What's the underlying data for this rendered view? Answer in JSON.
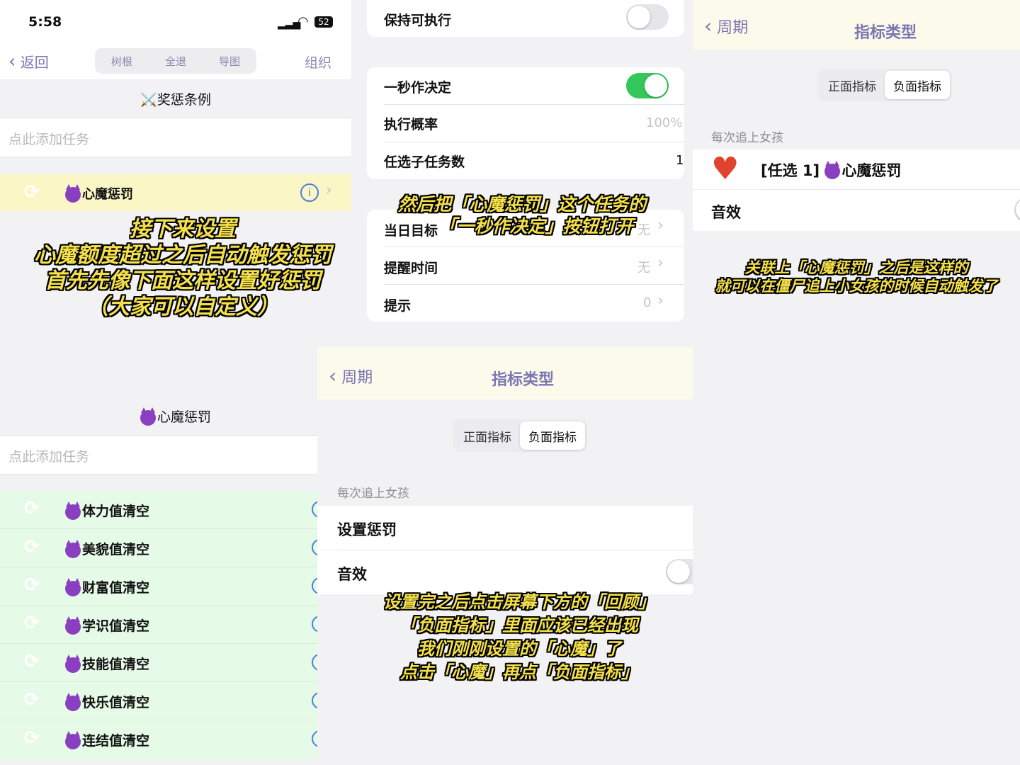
{
  "status_bar": {
    "time": "5:58",
    "battery": "52"
  },
  "left_panel": {
    "nav": {
      "back": "返回",
      "seg": [
        "树根",
        "全退",
        "导图"
      ],
      "right": "组织"
    },
    "section_title": "⚔️奖惩条例",
    "add_task_placeholder": "点此添加任务",
    "highlight_item": "心魔惩罚",
    "caption": [
      "接下来设置",
      "心魔额度超过之后自动触发惩罚",
      "首先先像下面这样设置好惩罚",
      "（大家可以自定义）"
    ]
  },
  "bottom_left_panel": {
    "section_title": "心魔惩罚",
    "add_task_placeholder": "点此添加任务",
    "items": [
      "体力值清空",
      "美貌值清空",
      "财富值清空",
      "学识值清空",
      "技能值清空",
      "快乐值清空",
      "连结值清空"
    ]
  },
  "middle_top_panel": {
    "keep_executable": "保持可执行",
    "one_second": "一秒作决定",
    "exec_prob_label": "执行概率",
    "exec_prob_value": "100%",
    "subtask_label": "任选子任务数",
    "subtask_value": "1",
    "daily_goal_label": "当日目标",
    "daily_goal_value": "无",
    "reminder_label": "提醒时间",
    "reminder_value": "无",
    "hint_label": "提示",
    "hint_value": "0",
    "caption": [
      "然后把「心魔惩罚」这个任务的",
      "「一秒作决定」按钮打开"
    ]
  },
  "middle_bottom_panel": {
    "nav": {
      "back": "周期",
      "title": "指标类型"
    },
    "seg": [
      "正面指标",
      "负面指标"
    ],
    "group_label": "每次追上女孩",
    "set_penalty": "设置惩罚",
    "sound": "音效",
    "caption": [
      "设置完之后点击屏幕下方的「回顾」",
      "「负面指标」里面应该已经出现",
      "我们刚刚设置的「心魔」了",
      "点击「心魔」再点「负面指标」"
    ]
  },
  "right_panel": {
    "nav": {
      "back": "周期",
      "title": "指标类型"
    },
    "seg": [
      "正面指标",
      "负面指标"
    ],
    "group_label": "每次追上女孩",
    "linked_prefix": "[任选 1]",
    "linked_task": "心魔惩罚",
    "sound": "音效",
    "caption": [
      "关联上「心魔惩罚」之后是这样的",
      "就可以在僵尸追上小女孩的时候自动触发了"
    ]
  },
  "colors": {
    "accent_purple": "#7b76b0",
    "toggle_green": "#34c759",
    "highlight_yellow": "#fbf6c5",
    "highlight_green": "#e6fbe7",
    "caption_yellow": "#f3e04a"
  }
}
